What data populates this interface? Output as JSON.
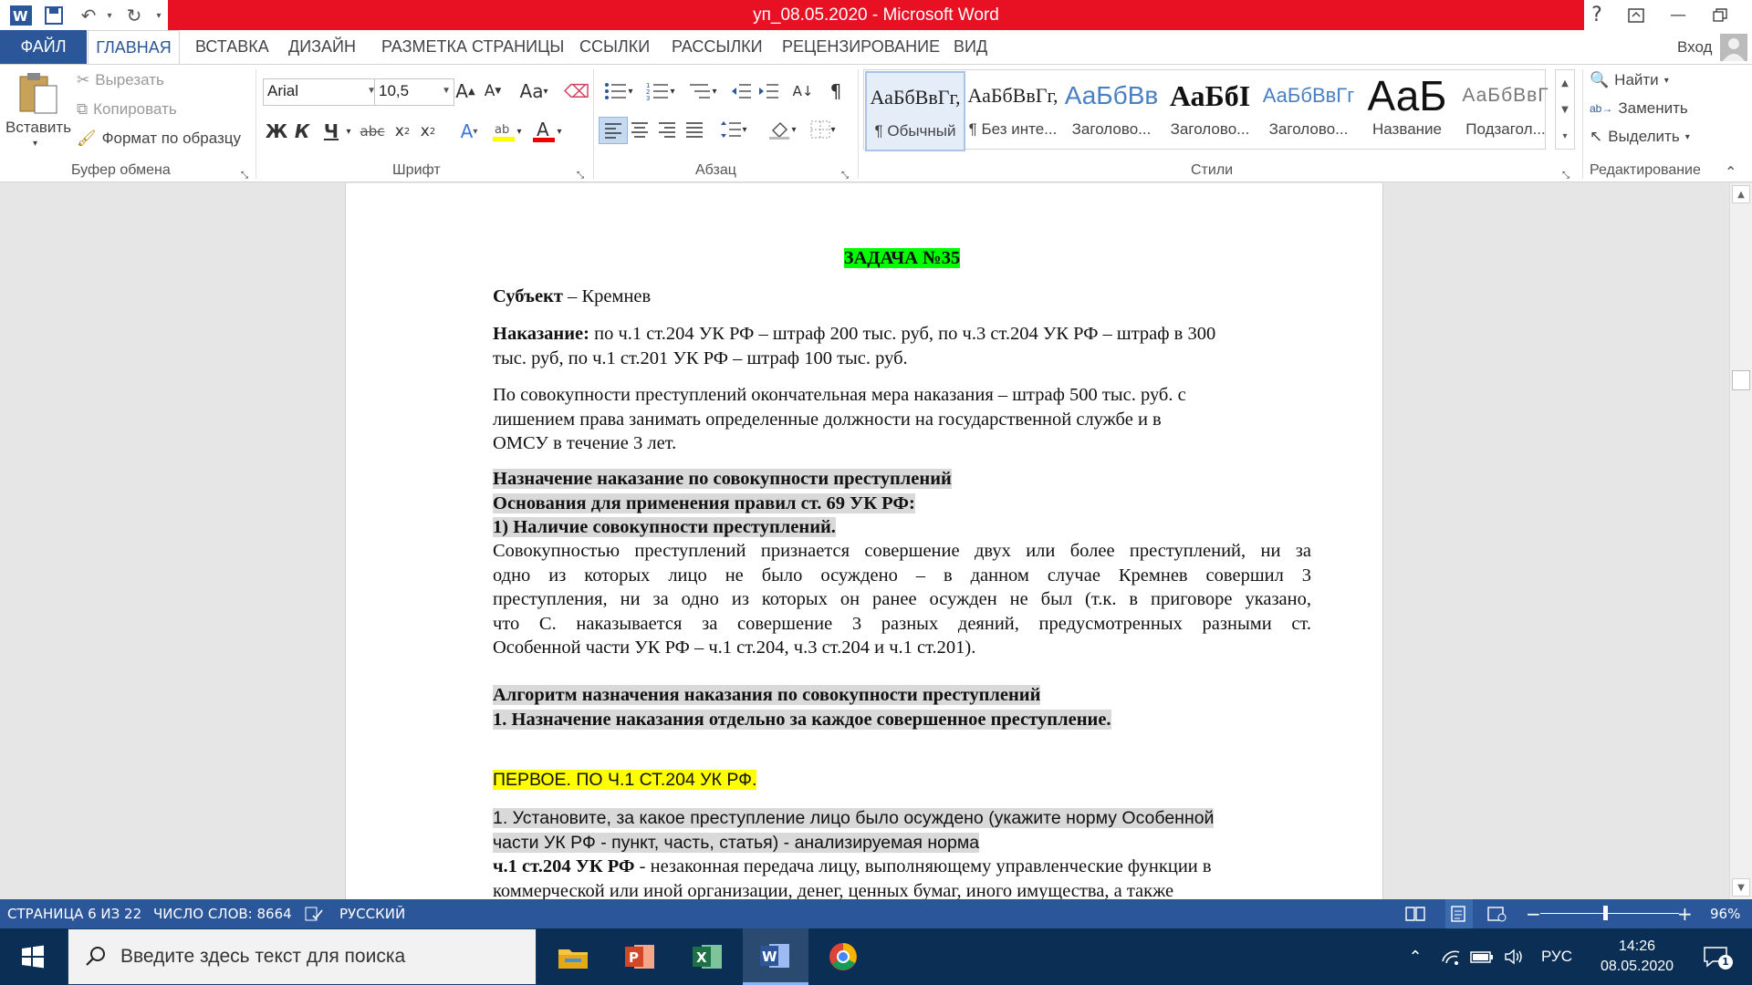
{
  "window": {
    "title": "уп_08.05.2020 -  Microsoft Word",
    "signin": "Вход",
    "help": "?"
  },
  "tabs": [
    "ФАЙЛ",
    "ГЛАВНАЯ",
    "ВСТАВКА",
    "ДИЗАЙН",
    "РАЗМЕТКА СТРАНИЦЫ",
    "ССЫЛКИ",
    "РАССЫЛКИ",
    "РЕЦЕНЗИРОВАНИЕ",
    "ВИД"
  ],
  "ribbon": {
    "clipboard": {
      "paste": "Вставить",
      "cut": "Вырезать",
      "copy": "Копировать",
      "format_painter": "Формат по образцу",
      "group": "Буфер обмена"
    },
    "font": {
      "name": "Arial",
      "size": "10,5",
      "bold": "Ж",
      "italic": "К",
      "underline": "Ч",
      "strike": "abc",
      "group": "Шрифт"
    },
    "paragraph": {
      "group": "Абзац"
    },
    "styles": {
      "items": [
        {
          "preview": "АаБбВвГг,",
          "name": "¶ Обычный"
        },
        {
          "preview": "АаБбВвГг,",
          "name": "¶ Без инте..."
        },
        {
          "preview": "АаБбВв",
          "name": "Заголово..."
        },
        {
          "preview": "АаБбI",
          "name": "Заголово..."
        },
        {
          "preview": "АаБбВвГг",
          "name": "Заголово..."
        },
        {
          "preview": "АаБ",
          "name": "Название"
        },
        {
          "preview": "АаБбВвГ",
          "name": "Подзагол..."
        }
      ],
      "group": "Стили"
    },
    "editing": {
      "find": "Найти",
      "replace": "Заменить",
      "select": "Выделить",
      "group": "Редактирование"
    }
  },
  "document": {
    "task_title": "ЗАДАЧА №35",
    "subject_label": "Субъект",
    "subject_value": " – Кремнев",
    "punishment_label": "Наказание:",
    "punishment_line1": " по ч.1 ст.204 УК РФ – штраф 200 тыс. руб, по ч.3 ст.204 УК РФ – штраф в 300",
    "punishment_line2": "тыс. руб, по ч.1 ст.201 УК РФ – штраф 100 тыс. руб.",
    "total_line1": "По совокупности преступлений окончательная мера наказания – штраф 500 тыс. руб. с",
    "total_line2": "лишением права занимать определенные должности на государственной службе и в",
    "total_line3": "ОМСУ в течение 3 лет.",
    "h1": "Назначение наказание по совокупности преступлений",
    "h2": " Основания для применения правил ст. 69 УК РФ:",
    "h3": "1) Наличие совокупности преступлений.",
    "body1": "Совокупностью преступлений признается совершение двух или более преступлений, ни за",
    "body2": "одно из которых лицо не было осуждено – в данном случае Кремнев совершил 3",
    "body3": "преступления, ни за одно из которых он ранее осужден не был (т.к. в приговоре указано,",
    "body4": "что С. наказывается за совершение 3 разных деяний, предусмотренных разными ст.",
    "body5": "Особенной части УК РФ – ч.1 ст.204, ч.3 ст.204 и ч.1 ст.201).",
    "alg1": "Алгоритм назначения наказания по совокупности преступлений",
    "alg2": "1. Назначение наказания отдельно за каждое совершенное преступление.",
    "first": "ПЕРВОЕ. ПО Ч.1 СТ.204 УК РФ.",
    "q1a": "1. Установите, за какое преступление лицо было осуждено (укажите норму Особенной",
    "q1b": "части УК РФ - пункт, часть, статья) - анализируемая норма",
    "norm_label": "ч.1 ст.204 УК РФ",
    "norm_text1": " - незаконная передача лицу, выполняющему управленческие функции в",
    "norm_text2": "коммерческой или иной организации, денег, ценных бумаг, иного имущества, а также"
  },
  "statusbar": {
    "page": "СТРАНИЦА 6 ИЗ 22",
    "words": "ЧИСЛО СЛОВ: 8664",
    "language": "РУССКИЙ",
    "zoom": "96%"
  },
  "taskbar": {
    "search_placeholder": "Введите здесь текст для поиска",
    "lang": "РУС",
    "time": "14:26",
    "date": "08.05.2020",
    "notifications": "1"
  }
}
